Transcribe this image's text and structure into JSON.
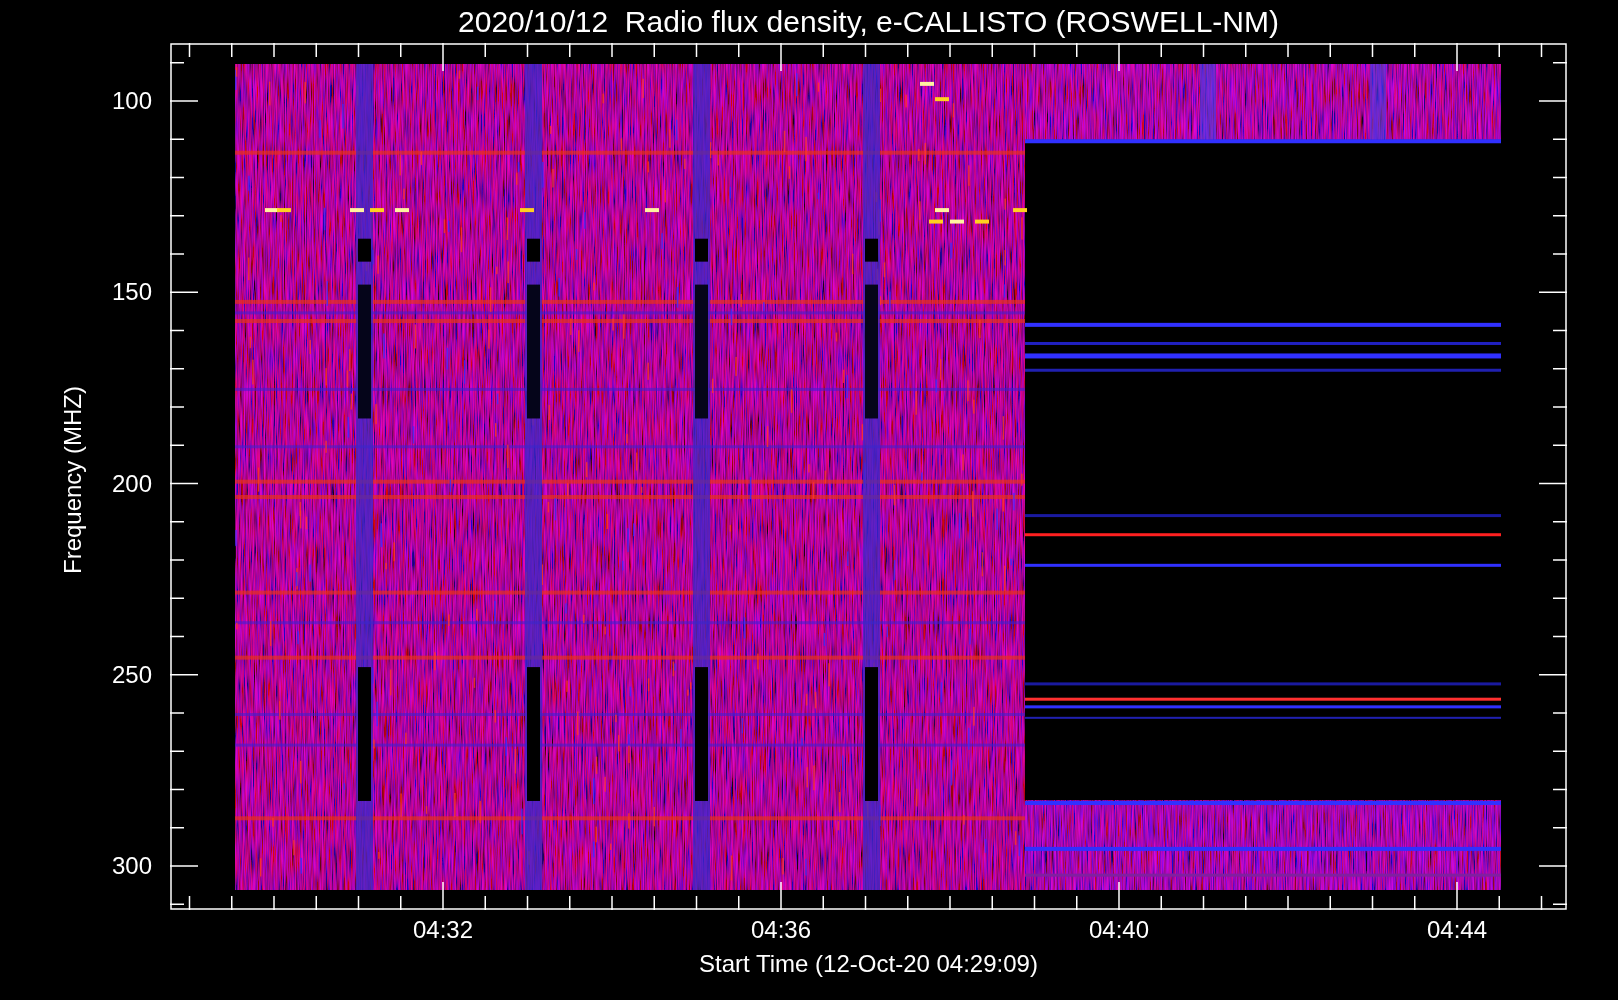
{
  "title": "2020/10/12  Radio flux density, e-CALLISTO (ROSWELL-NM)",
  "y_axis": {
    "label": "Frequency (MHZ)",
    "ticks": [
      "100",
      "150",
      "200",
      "250",
      "300"
    ]
  },
  "x_axis": {
    "label": "Start Time (12-Oct-20 04:29:09)",
    "ticks": [
      "04:32",
      "04:36",
      "04:40",
      "04:44"
    ]
  }
}
